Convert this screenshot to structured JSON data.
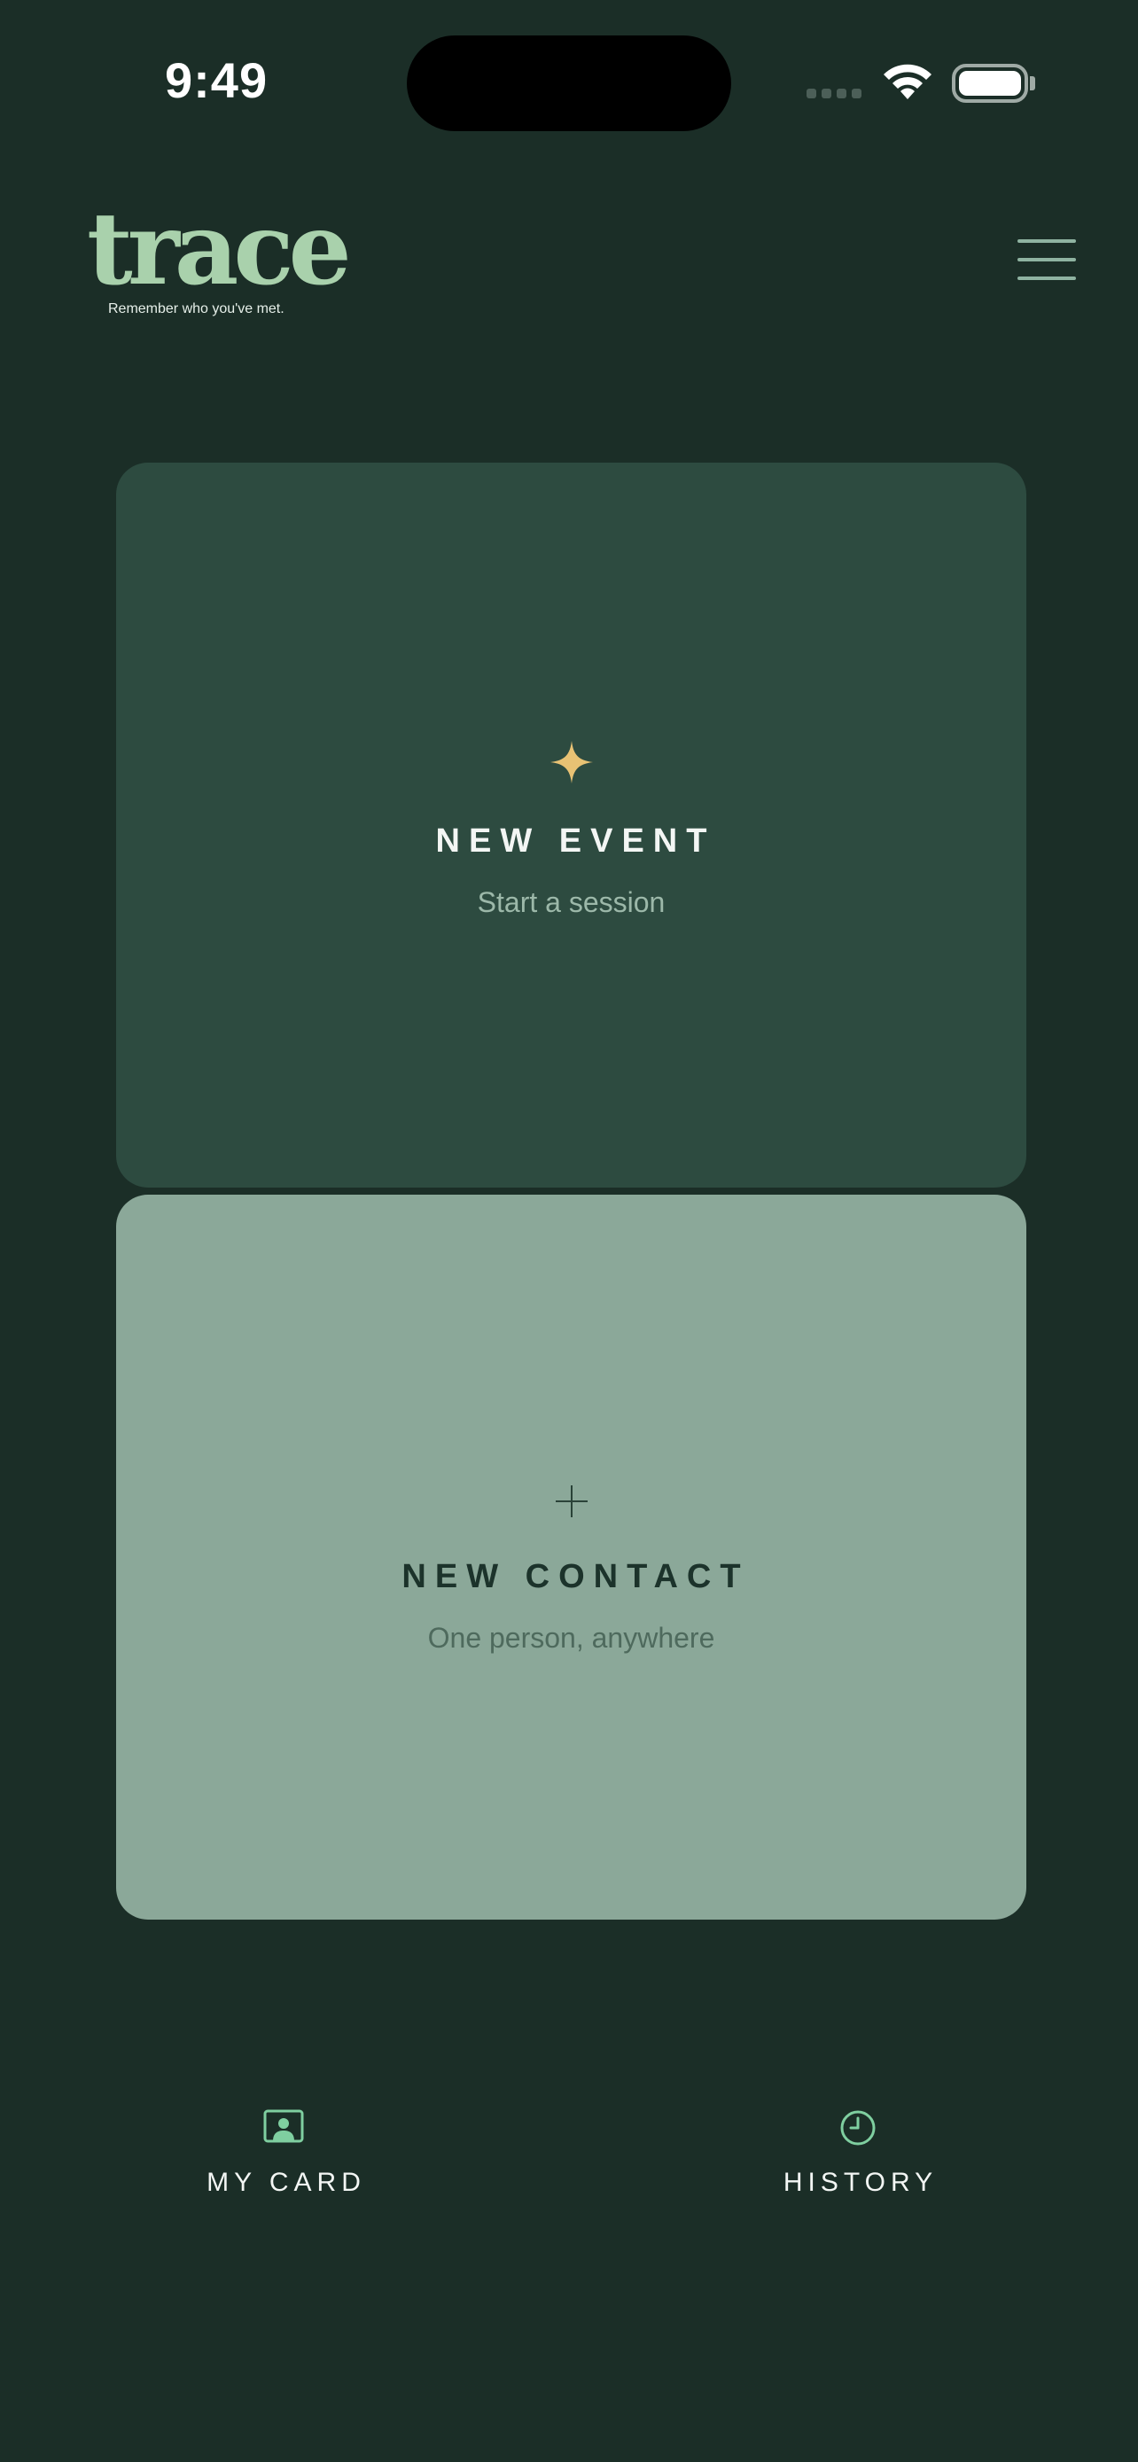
{
  "status_bar": {
    "time": "9:49"
  },
  "header": {
    "logo_word": "trace",
    "tagline": "Remember who you've met.",
    "menu_icon": "hamburger-menu-icon"
  },
  "cards": {
    "event": {
      "icon": "sparkle-icon",
      "title": "NEW EVENT",
      "subtitle": "Start a session"
    },
    "contact": {
      "icon": "plus-icon",
      "title": "NEW CONTACT",
      "subtitle": "One person, anywhere"
    }
  },
  "bottom_nav": {
    "my_card": {
      "icon": "contact-card-icon",
      "label": "MY CARD"
    },
    "history": {
      "icon": "clock-icon",
      "label": "HISTORY"
    }
  },
  "colors": {
    "background": "#1B2E27",
    "event_card": "#2D4B40",
    "contact_card": "#8BA899",
    "logo": "#A9D1AC",
    "sparkle": "#E8C274",
    "nav_icon": "#7FCFA0"
  }
}
